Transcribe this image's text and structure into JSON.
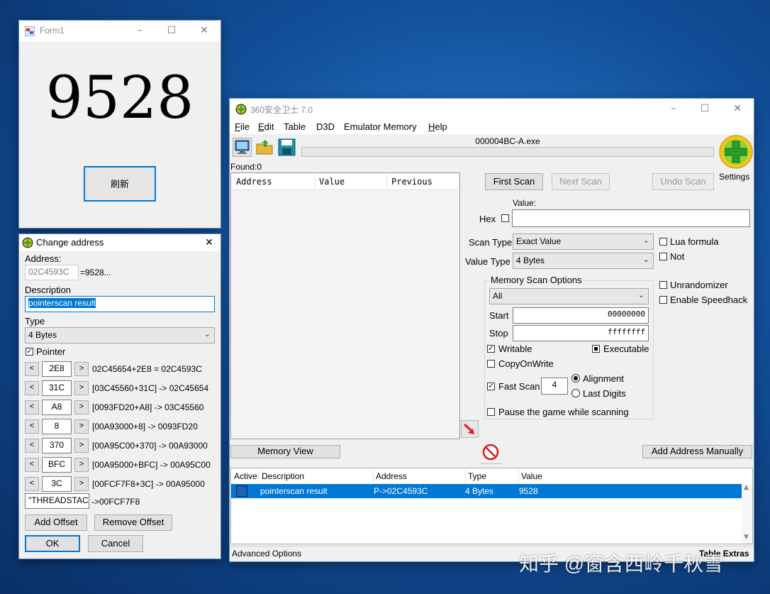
{
  "form1": {
    "title": "Form1",
    "number": "9528",
    "refresh_label": "刷新"
  },
  "change_address": {
    "title": "Change address",
    "address_label": "Address:",
    "address_value": "02C4593C",
    "address_result": "=9528...",
    "description_label": "Description",
    "description_value": "pointerscan result",
    "type_label": "Type",
    "type_value": "4 Bytes",
    "pointer_label": "Pointer",
    "pointer_checked": true,
    "offsets": [
      {
        "offset": "2E8",
        "text": "02C45654+2E8 = 02C4593C"
      },
      {
        "offset": "31C",
        "text": "[03C45560+31C] -> 02C45654"
      },
      {
        "offset": "A8",
        "text": "[0093FD20+A8] -> 03C45560"
      },
      {
        "offset": "8",
        "text": "[00A93000+8] -> 0093FD20"
      },
      {
        "offset": "370",
        "text": "[00A95C00+370] -> 00A93000"
      },
      {
        "offset": "BFC",
        "text": "[00A95000+BFC] -> 00A95C00"
      },
      {
        "offset": "3C",
        "text": "[00FCF7F8+3C] -> 00A95000"
      }
    ],
    "base_value": "\"THREADSTACK",
    "base_result": "->00FCF7F8",
    "add_offset": "Add Offset",
    "remove_offset": "Remove Offset",
    "ok": "OK",
    "cancel": "Cancel"
  },
  "ce": {
    "title": "360安全卫士 7.0",
    "menu": [
      "File",
      "Edit",
      "Table",
      "D3D",
      "Emulator Memory",
      "Help"
    ],
    "process": "000004BC-A.exe",
    "found": "Found:0",
    "settings": "Settings",
    "list_headers": [
      "Address",
      "Value",
      "Previous"
    ],
    "first_scan": "First Scan",
    "next_scan": "Next Scan",
    "undo_scan": "Undo Scan",
    "value_label": "Value:",
    "hex_label": "Hex",
    "scan_type_label": "Scan Type",
    "scan_type_value": "Exact Value",
    "value_type_label": "Value Type",
    "value_type_value": "4 Bytes",
    "lua_formula": "Lua formula",
    "not": "Not",
    "mem_options_title": "Memory Scan Options",
    "mem_region": "All",
    "start_label": "Start",
    "start_value": "00000000",
    "stop_label": "Stop",
    "stop_value": "ffffffff",
    "writable": "Writable",
    "executable": "Executable",
    "copyonwrite": "CopyOnWrite",
    "fast_scan": "Fast Scan",
    "fast_scan_value": "4",
    "alignment": "Alignment",
    "last_digits": "Last Digits",
    "pause": "Pause the game while scanning",
    "unrandomizer": "Unrandomizer",
    "speedhack": "Enable Speedhack",
    "memory_view": "Memory View",
    "add_manually": "Add Address Manually",
    "table_headers": [
      "Active",
      "Description",
      "Address",
      "Type",
      "Value"
    ],
    "table_rows": [
      {
        "description": "pointerscan result",
        "address": "P->02C4593C",
        "type": "4 Bytes",
        "value": "9528"
      }
    ],
    "advanced_options": "Advanced Options",
    "table_extras": "Table Extras"
  },
  "watermark": "知乎 @窗含西岭千秋雪",
  "colors": {
    "selection": "#0078d7",
    "accent": "#0063b1"
  }
}
